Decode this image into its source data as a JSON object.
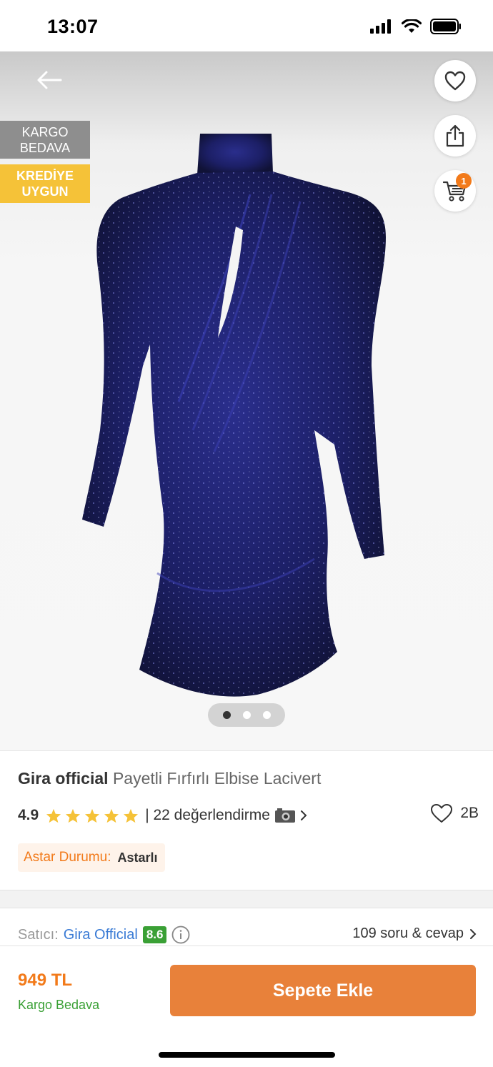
{
  "status_bar": {
    "time": "13:07"
  },
  "badges": {
    "cargo": [
      "KARGO",
      "BEDAVA"
    ],
    "credit": [
      "KREDİYE",
      "UYGUN"
    ]
  },
  "cart": {
    "count": "1"
  },
  "gallery": {
    "image_count": 3,
    "active_index": 0
  },
  "product": {
    "brand": "Gira official",
    "name": "Payetli Fırfırlı Elbise Lacivert",
    "rating": "4.9",
    "stars": 5,
    "reviews": "| 22 değerlendirme",
    "favorites": "2B",
    "attribute": {
      "label": "Astar Durumu:",
      "value": "Astarlı"
    }
  },
  "seller": {
    "label": "Satıcı:",
    "name": "Gira Official",
    "score": "8.6",
    "qa": "109 soru & cevap"
  },
  "bottom": {
    "price": "949 TL",
    "shipping": "Kargo Bedava",
    "add_to_cart": "Sepete Ekle"
  },
  "colors": {
    "accent": "#f27a1a",
    "button": "#e8813a",
    "green": "#3aa035",
    "link": "#3a7bd5",
    "credit_badge": "#f5c238",
    "star": "#f5c238"
  }
}
